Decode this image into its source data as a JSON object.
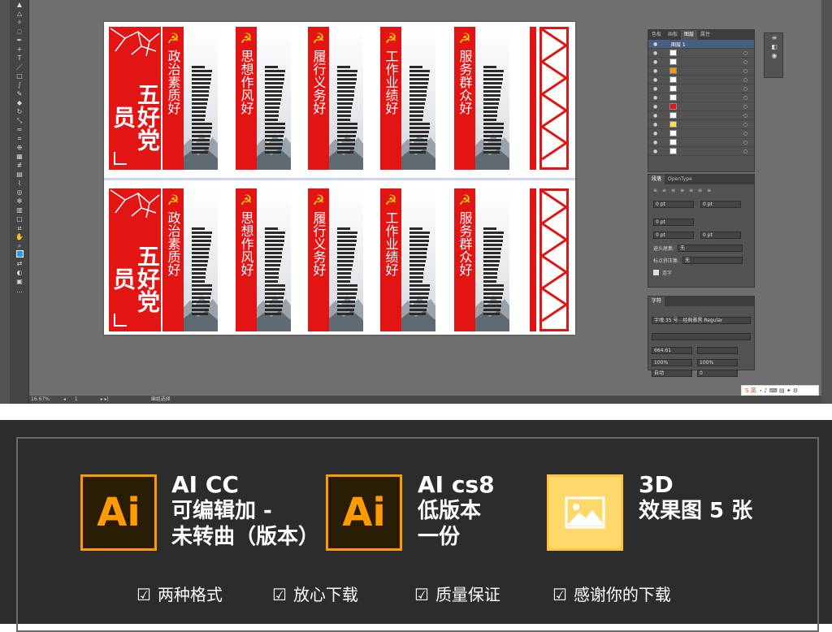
{
  "canvas": {
    "title_text": "五好党员",
    "cards": [
      {
        "label": "政治素质好"
      },
      {
        "label": "思想作风好"
      },
      {
        "label": "履行义务好"
      },
      {
        "label": "工作业绩好"
      },
      {
        "label": "服务群众好"
      }
    ]
  },
  "layers_panel": {
    "tabs": [
      "色板",
      "画板",
      "图层",
      "属性"
    ],
    "active_tab": "图层",
    "top_layer": "图层 1"
  },
  "paragraph_panel": {
    "tabs": [
      "段落",
      "OpenType"
    ],
    "indent_left": "0 pt",
    "indent_right": "0 pt",
    "first_indent": "0 pt",
    "space_before": "0 pt",
    "space_after": "0 pt",
    "kinsoku_label": "避头尾集:",
    "kinsoku_value": "无",
    "mojikumi_label": "标点挤压集:",
    "mojikumi_value": "无",
    "hyphen_label": "连字"
  },
  "character_panel": {
    "tab": "字符",
    "font": "字魂 35 号 - 经典雅黑 Regular",
    "size": "664.61",
    "scale_v": "100%",
    "scale_h": "100%",
    "leading": "自动",
    "tracking": "0"
  },
  "status": {
    "zoom": "16.67%",
    "page": "1",
    "tool": "编组选择"
  },
  "ime": {
    "label": "英"
  },
  "promo": {
    "formats": [
      {
        "icon": "Ai",
        "line1": "AI CC",
        "line2": "可编辑加 -",
        "line3": "未转曲（版本）"
      },
      {
        "icon": "Ai",
        "line1": "AI cs8",
        "line2": "低版本",
        "line3": "一份"
      },
      {
        "icon": "",
        "line1": "3D",
        "line2": "效果图 5 张",
        "line3": ""
      }
    ],
    "checks": [
      "两种格式",
      "放心下载",
      "质量保证",
      "感谢你的下载"
    ]
  },
  "colors": {
    "red": "#e31414",
    "gold": "#ffd800",
    "orange": "#ff9a00"
  }
}
